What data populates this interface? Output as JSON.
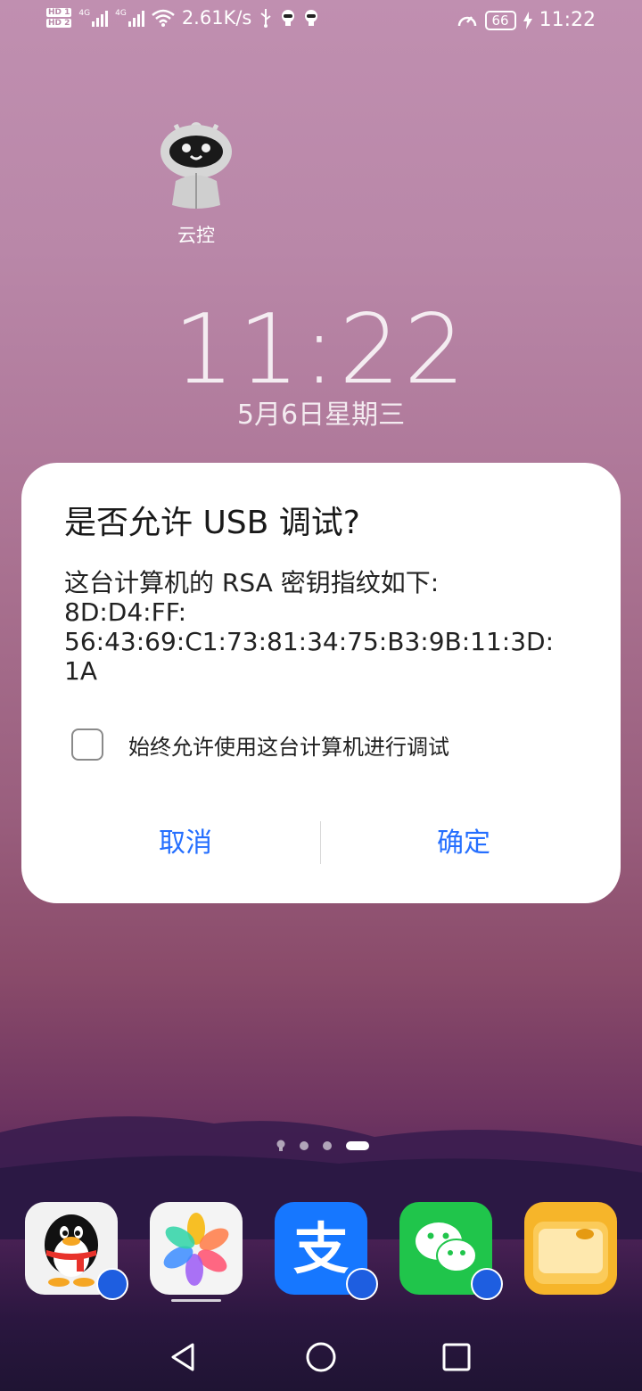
{
  "status_bar": {
    "net_speed": "2.61K/s",
    "hd1": "HD 1",
    "hd2": "HD 2",
    "net_type_1": "4G",
    "net_type_2": "4G",
    "battery": "66",
    "time": "11:22"
  },
  "home": {
    "app_yunkong_label": "云控",
    "clock": "11:22",
    "date": "5月6日星期三"
  },
  "dialog": {
    "title": "是否允许 USB 调试?",
    "body_line1": "这台计算机的 RSA 密钥指纹如下:",
    "body_line2": "8D:D4:FF:",
    "body_line3": "56:43:69:C1:73:81:34:75:B3:9B:11:3D:",
    "body_line4": "1A",
    "checkbox_label": "始终允许使用这台计算机进行调试",
    "checkbox_checked": false,
    "cancel_label": "取消",
    "ok_label": "确定",
    "button_color": "#256fff"
  },
  "page_indicator": {
    "count": 4,
    "active_index": 3
  },
  "dock": {
    "apps": [
      "qq-app",
      "gallery-app",
      "alipay-app",
      "wechat-app",
      "files-app"
    ]
  },
  "nav": {
    "icons": [
      "back-icon",
      "home-icon",
      "recents-icon"
    ]
  }
}
